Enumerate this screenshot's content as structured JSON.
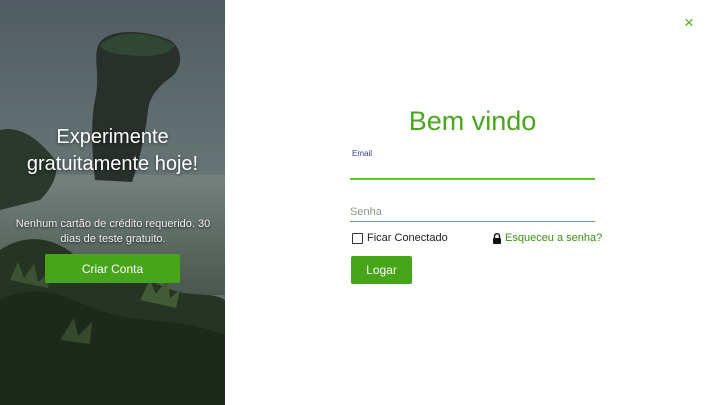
{
  "promo": {
    "title": "Experimente gratuitamente hoje!",
    "text": "Nenhum cartão de crédito requerido. 30 dias de teste gratuito.",
    "button_label": "Criar Conta"
  },
  "dialog": {
    "close_icon": "×",
    "welcome_title": "Bem vindo"
  },
  "form": {
    "email_label": "Email",
    "email_value": "",
    "password_placeholder": "Senha",
    "password_value": "",
    "remember_label": "Ficar Conectado",
    "remember_checked": false,
    "forgot_label": "Esqueceu a senha?",
    "login_label": "Logar"
  },
  "colors": {
    "accent": "#46a519",
    "title_green": "#48a71b",
    "link_green": "#3b8f14"
  },
  "icons": {
    "close": "close-icon",
    "lock": "lock-icon"
  }
}
